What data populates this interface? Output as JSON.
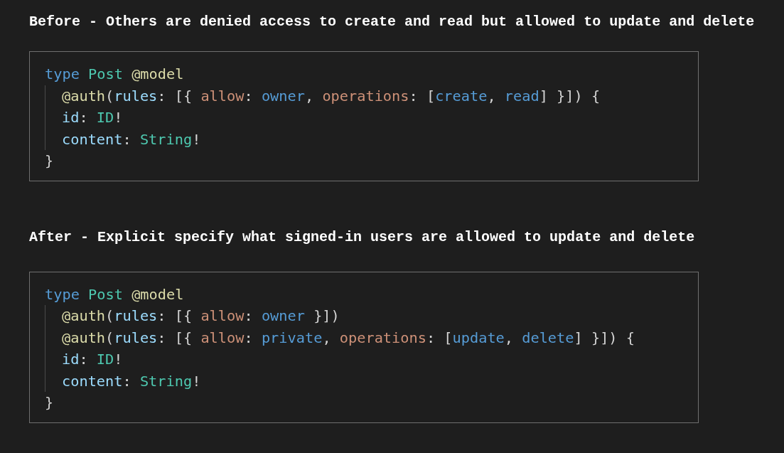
{
  "sections": [
    {
      "heading": "Before - Others are denied access to create and read but allowed to update and delete",
      "code": [
        {
          "tokens": [
            {
              "text": "type ",
              "kind": "keyword"
            },
            {
              "text": "Post ",
              "kind": "type"
            },
            {
              "text": "@model",
              "kind": "directive"
            }
          ],
          "children": [
            {
              "tokens": [
                {
                  "text": "@auth",
                  "kind": "directive"
                },
                {
                  "text": "(",
                  "kind": "punctuation"
                },
                {
                  "text": "rules",
                  "kind": "field"
                },
                {
                  "text": ": [{ ",
                  "kind": "punctuation"
                },
                {
                  "text": "allow",
                  "kind": "argument"
                },
                {
                  "text": ": ",
                  "kind": "punctuation"
                },
                {
                  "text": "owner",
                  "kind": "value"
                },
                {
                  "text": ", ",
                  "kind": "punctuation"
                },
                {
                  "text": "operations",
                  "kind": "argument"
                },
                {
                  "text": ": [",
                  "kind": "punctuation"
                },
                {
                  "text": "create",
                  "kind": "value"
                },
                {
                  "text": ", ",
                  "kind": "punctuation"
                },
                {
                  "text": "read",
                  "kind": "value"
                },
                {
                  "text": "] }]) {",
                  "kind": "punctuation"
                }
              ]
            },
            {
              "tokens": [
                {
                  "text": "id",
                  "kind": "field"
                },
                {
                  "text": ": ",
                  "kind": "punctuation"
                },
                {
                  "text": "ID",
                  "kind": "type"
                },
                {
                  "text": "!",
                  "kind": "punctuation"
                }
              ]
            },
            {
              "tokens": [
                {
                  "text": "content",
                  "kind": "field"
                },
                {
                  "text": ": ",
                  "kind": "punctuation"
                },
                {
                  "text": "String",
                  "kind": "type"
                },
                {
                  "text": "!",
                  "kind": "punctuation"
                }
              ]
            }
          ]
        },
        {
          "tokens": [
            {
              "text": "}",
              "kind": "punctuation"
            }
          ]
        }
      ]
    },
    {
      "heading": "After - Explicit specify what signed-in users are allowed to update and delete",
      "code": [
        {
          "tokens": [
            {
              "text": "type ",
              "kind": "keyword"
            },
            {
              "text": "Post ",
              "kind": "type"
            },
            {
              "text": "@model",
              "kind": "directive"
            }
          ],
          "children": [
            {
              "tokens": [
                {
                  "text": "@auth",
                  "kind": "directive"
                },
                {
                  "text": "(",
                  "kind": "punctuation"
                },
                {
                  "text": "rules",
                  "kind": "field"
                },
                {
                  "text": ": [{ ",
                  "kind": "punctuation"
                },
                {
                  "text": "allow",
                  "kind": "argument"
                },
                {
                  "text": ": ",
                  "kind": "punctuation"
                },
                {
                  "text": "owner",
                  "kind": "value"
                },
                {
                  "text": " }])",
                  "kind": "punctuation"
                }
              ]
            },
            {
              "tokens": [
                {
                  "text": "@auth",
                  "kind": "directive"
                },
                {
                  "text": "(",
                  "kind": "punctuation"
                },
                {
                  "text": "rules",
                  "kind": "field"
                },
                {
                  "text": ": [{ ",
                  "kind": "punctuation"
                },
                {
                  "text": "allow",
                  "kind": "argument"
                },
                {
                  "text": ": ",
                  "kind": "punctuation"
                },
                {
                  "text": "private",
                  "kind": "value"
                },
                {
                  "text": ", ",
                  "kind": "punctuation"
                },
                {
                  "text": "operations",
                  "kind": "argument"
                },
                {
                  "text": ": [",
                  "kind": "punctuation"
                },
                {
                  "text": "update",
                  "kind": "value"
                },
                {
                  "text": ", ",
                  "kind": "punctuation"
                },
                {
                  "text": "delete",
                  "kind": "value"
                },
                {
                  "text": "] }]) {",
                  "kind": "punctuation"
                }
              ]
            },
            {
              "tokens": [
                {
                  "text": "id",
                  "kind": "field"
                },
                {
                  "text": ": ",
                  "kind": "punctuation"
                },
                {
                  "text": "ID",
                  "kind": "type"
                },
                {
                  "text": "!",
                  "kind": "punctuation"
                }
              ]
            },
            {
              "tokens": [
                {
                  "text": "content",
                  "kind": "field"
                },
                {
                  "text": ": ",
                  "kind": "punctuation"
                },
                {
                  "text": "String",
                  "kind": "type"
                },
                {
                  "text": "!",
                  "kind": "punctuation"
                }
              ]
            }
          ]
        },
        {
          "tokens": [
            {
              "text": "}",
              "kind": "punctuation"
            }
          ]
        }
      ]
    }
  ]
}
